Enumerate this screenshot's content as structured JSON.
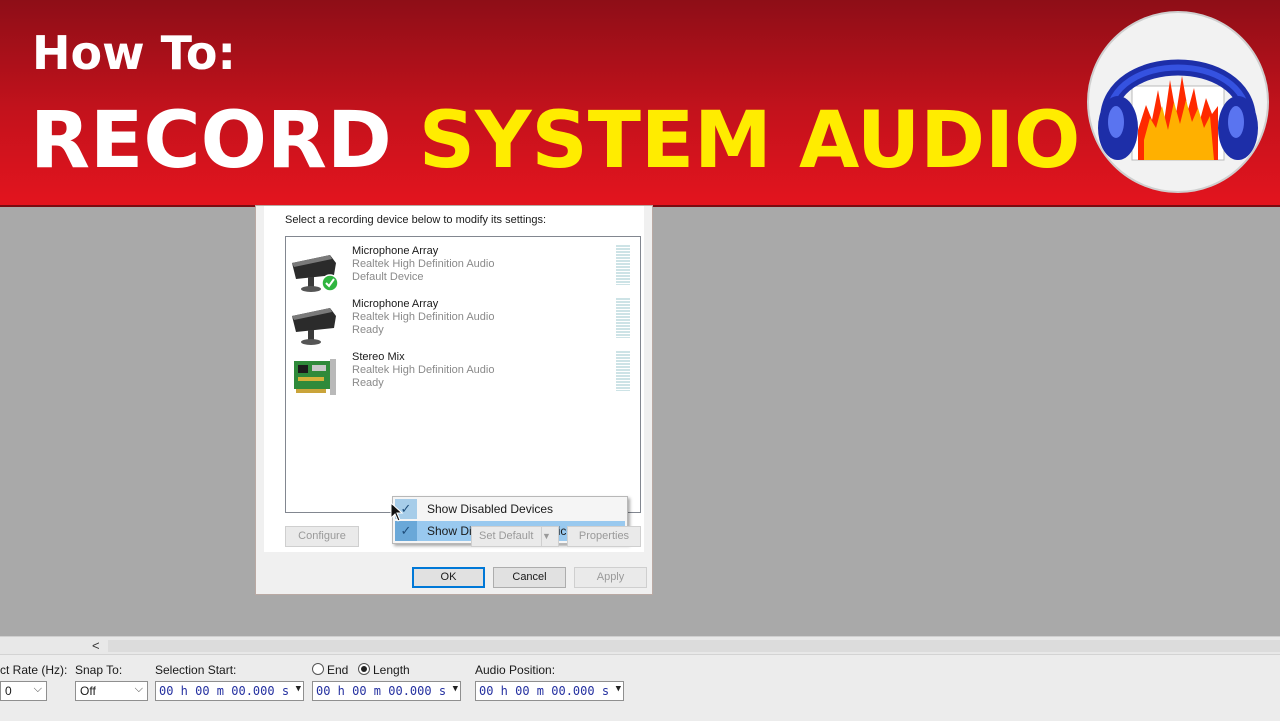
{
  "banner": {
    "line1": "How To:",
    "line2_white": "RECORD",
    "line2_yellow": "SYSTEM AUDIO",
    "logo_icon": "audacity-headphones-icon",
    "colors": {
      "background": "#c4121c",
      "highlight": "#ffec00"
    }
  },
  "dialog": {
    "prompt": "Select a recording device below to modify its settings:",
    "devices": [
      {
        "name": "Microphone Array",
        "driver": "Realtek High Definition Audio",
        "status": "Default Device",
        "icon": "microphone-array-icon",
        "default": true
      },
      {
        "name": "Microphone Array",
        "driver": "Realtek High Definition Audio",
        "status": "Ready",
        "icon": "microphone-array-icon",
        "default": false
      },
      {
        "name": "Stereo Mix",
        "driver": "Realtek High Definition Audio",
        "status": "Ready",
        "icon": "sound-card-icon",
        "default": false
      }
    ],
    "context_menu": {
      "items": [
        {
          "label": "Show Disabled Devices",
          "checked": true
        },
        {
          "label": "Show Disconnected Devices",
          "checked": true
        }
      ]
    },
    "buttons": {
      "configure": "Configure",
      "set_default": "Set Default",
      "properties": "Properties",
      "ok": "OK",
      "cancel": "Cancel",
      "apply": "Apply"
    }
  },
  "toolbar": {
    "scroll_left": "<",
    "rate_label": "ct Rate (Hz):",
    "rate_value": "0",
    "snap_label": "Snap To:",
    "snap_value": "Off",
    "selection_start_label": "Selection Start:",
    "end_label": "End",
    "length_label": "Length",
    "audio_position_label": "Audio Position:",
    "selection_start_value": "00 h 00 m 00.000 s",
    "length_value": "00 h 00 m 00.000 s",
    "audio_position_value": "00 h 00 m 00.000 s",
    "selected_mode": "Length"
  }
}
